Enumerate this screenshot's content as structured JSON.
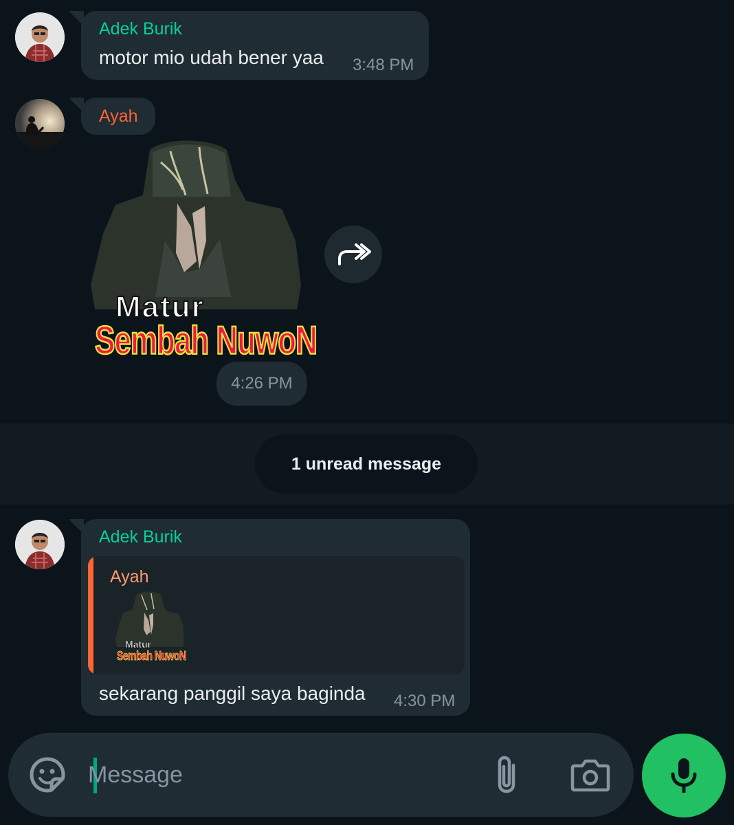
{
  "messages": [
    {
      "sender": "Adek Burik",
      "sender_color": "#06cf9c",
      "text": "motor mio udah bener yaa",
      "time": "3:48 PM"
    },
    {
      "sender": "Ayah",
      "sender_color": "#fe6533",
      "sticker": {
        "line1": "Matur",
        "line2": "Sembah NuwoN"
      },
      "time": "4:26 PM"
    },
    {
      "sender": "Adek Burik",
      "sender_color": "#06cf9c",
      "quote": {
        "sender": "Ayah",
        "sticker": {
          "line1": "Matur",
          "line2": "Sembah NuwoN"
        }
      },
      "text": "sekarang panggil saya baginda",
      "time": "4:30 PM"
    }
  ],
  "unread_divider": "1 unread message",
  "composer": {
    "placeholder": "Message",
    "icons": [
      "sticker-icon",
      "attach-icon",
      "camera-icon",
      "mic-icon"
    ]
  },
  "colors": {
    "background": "#0b141a",
    "bubble": "#202c33",
    "accent": "#21c063"
  }
}
